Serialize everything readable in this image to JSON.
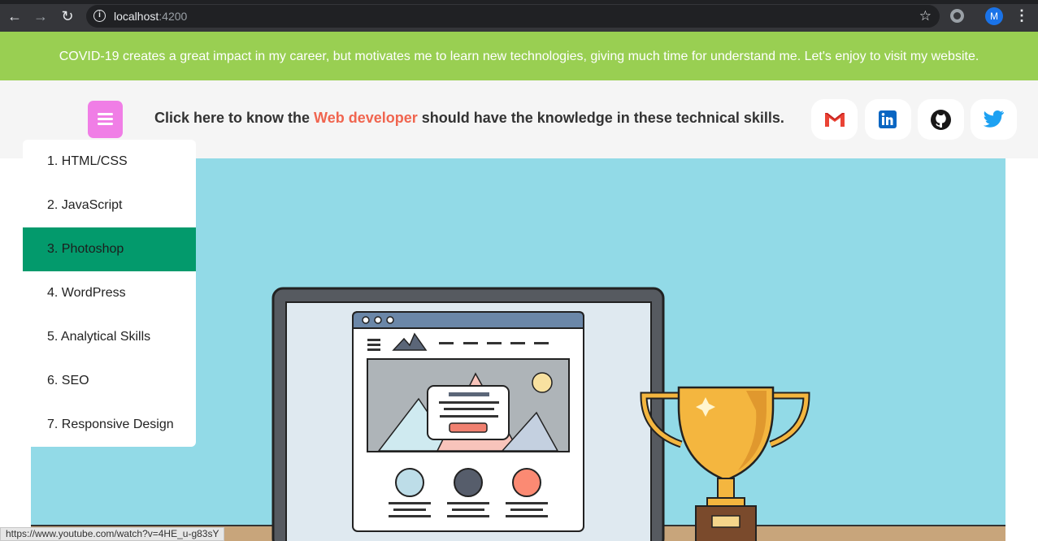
{
  "browser": {
    "host": "localhost",
    "port": ":4200",
    "profile_initial": "M"
  },
  "banner": {
    "text": "COVID-19 creates a great impact in my career, but motivates me to learn new technologies, giving much time for understand me. Let's enjoy to visit my website."
  },
  "header": {
    "headline_prefix": "Click here to know the ",
    "headline_highlight": "Web developer",
    "headline_suffix": " should have the knowledge in these technical skills.",
    "social": [
      "gmail-icon",
      "linkedin-icon",
      "github-icon",
      "twitter-icon"
    ]
  },
  "menu": {
    "items": [
      {
        "label": "1. HTML/CSS"
      },
      {
        "label": "2. JavaScript"
      },
      {
        "label": "3. Photoshop"
      },
      {
        "label": "4. WordPress"
      },
      {
        "label": "5. Analytical Skills"
      },
      {
        "label": "6. SEO"
      },
      {
        "label": "7. Responsive Design"
      }
    ],
    "active_index": 2
  },
  "status": {
    "url": "https://www.youtube.com/watch?v=4HE_u-g83sY"
  },
  "colors": {
    "banner": "#99cf52",
    "menu_button": "#f07ee6",
    "highlight": "#f0654f",
    "active_item": "#039a6c",
    "hero_bg": "#92dae7"
  }
}
